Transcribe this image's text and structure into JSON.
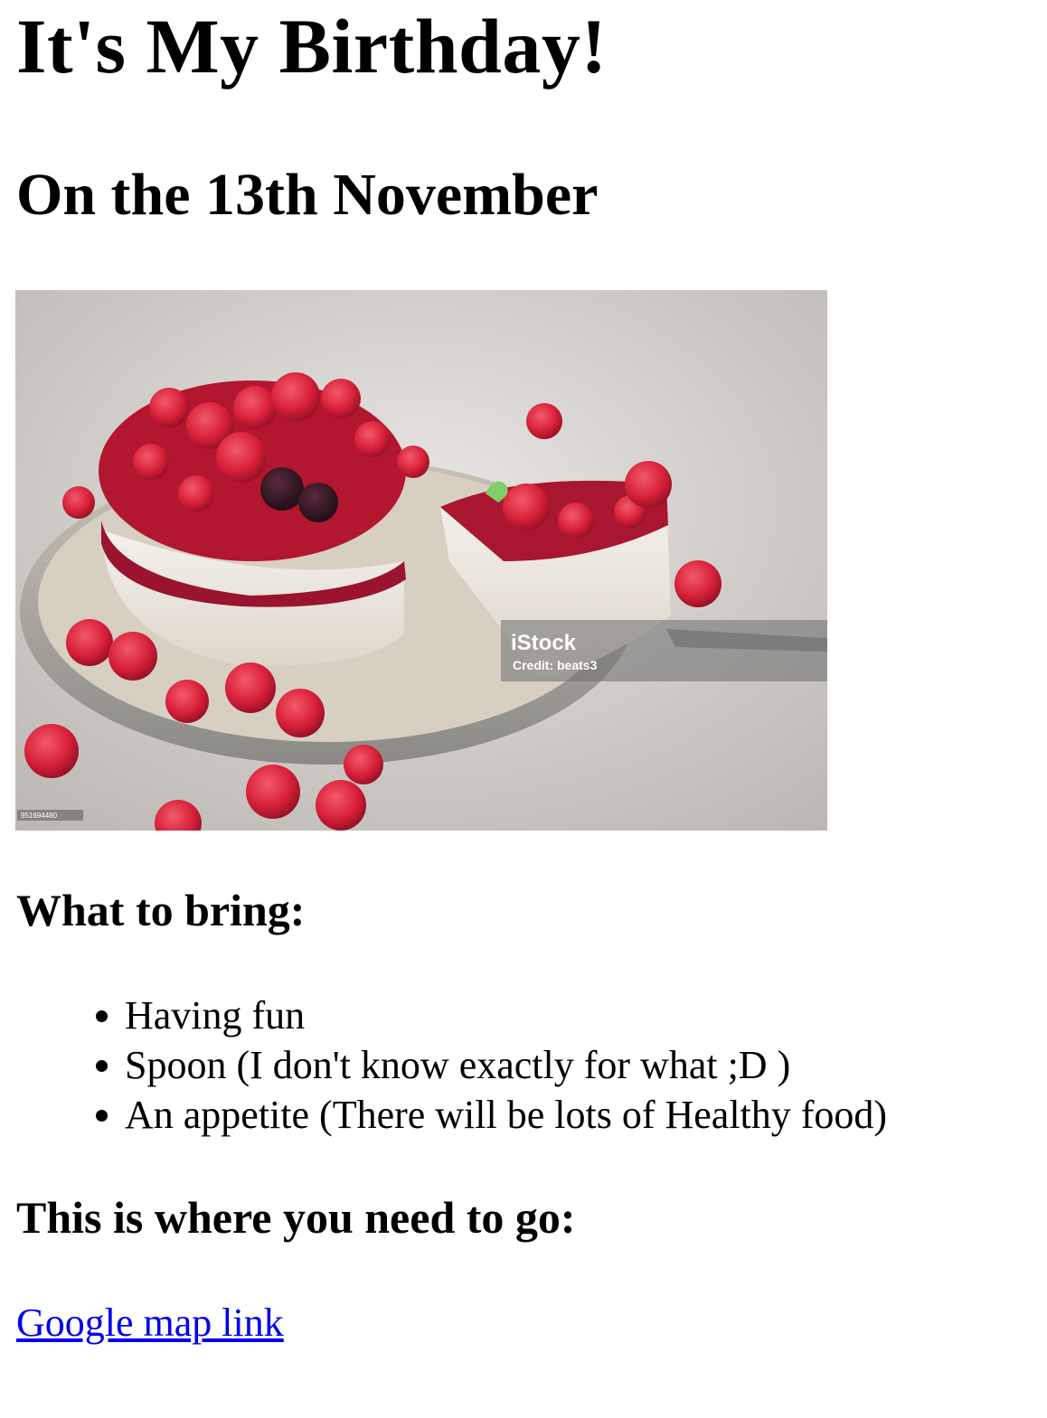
{
  "page": {
    "title": "It's My Birthday!",
    "subtitle": "On the 13th November"
  },
  "photo": {
    "subject": "berry-cheesecake",
    "watermark_brand": "iStock",
    "watermark_credit": "Credit: beats3",
    "image_id": "951694480"
  },
  "bring": {
    "heading": "What to bring:",
    "items": [
      "Having fun",
      "Spoon (I don't know exactly for what ;D )",
      "An appetite (There will be lots of Healthy food)"
    ]
  },
  "location": {
    "heading": "This is where you need to go:",
    "link_label": "Google map link"
  },
  "colors": {
    "link": "#0000ee",
    "text": "#000000"
  }
}
